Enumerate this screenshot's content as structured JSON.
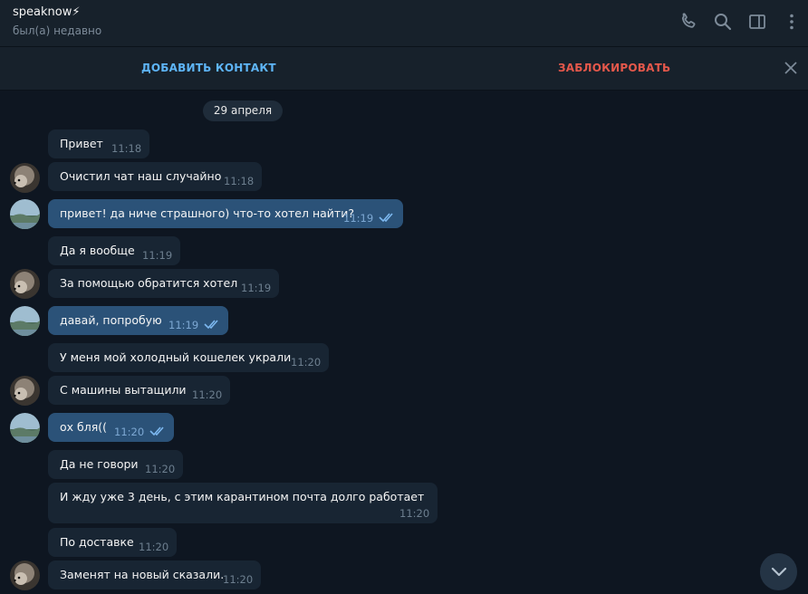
{
  "header": {
    "name": "speaknow⚡",
    "status": "был(а) недавно"
  },
  "actionbar": {
    "add_contact": "ДОБАВИТЬ КОНТАКТ",
    "block": "ЗАБЛОКИРОВАТЬ"
  },
  "date": "29 апреля",
  "colors": {
    "background": "#0e1621",
    "header": "#17212b",
    "incoming_bubble": "#182533",
    "outgoing_bubble": "#2b5278",
    "link": "#5eb5f7",
    "danger": "#e5584b"
  },
  "messages": [
    {
      "text": "Привет",
      "time": "11:18",
      "dir": "in"
    },
    {
      "text": "Очистил чат наш случайно",
      "time": "11:18",
      "dir": "in"
    },
    {
      "text": "привет! да ниче страшного) что-то хотел найти?",
      "time": "11:19",
      "dir": "out"
    },
    {
      "text": "Да я вообще",
      "time": "11:19",
      "dir": "in"
    },
    {
      "text": "За помощью обратится хотел",
      "time": "11:19",
      "dir": "in"
    },
    {
      "text": "давай, попробую",
      "time": "11:19",
      "dir": "out"
    },
    {
      "text": "У меня мой холодный кошелек украли",
      "time": "11:20",
      "dir": "in"
    },
    {
      "text": "С машины вытащили",
      "time": "11:20",
      "dir": "in"
    },
    {
      "text": "ох бля((",
      "time": "11:20",
      "dir": "out"
    },
    {
      "text": "Да не говори",
      "time": "11:20",
      "dir": "in"
    },
    {
      "text": "И жду уже 3 день, с этим карантином почта долго работает",
      "time": "11:20",
      "dir": "in"
    },
    {
      "text": "По доставке",
      "time": "11:20",
      "dir": "in"
    },
    {
      "text": "Заменят на новый сказали.",
      "time": "11:20",
      "dir": "in"
    }
  ],
  "icons": {
    "call": "phone-icon",
    "search": "search-icon",
    "sidebar": "sidebar-toggle-icon",
    "more": "more-vertical-icon",
    "close": "close-icon",
    "read": "double-check-icon",
    "scroll": "chevron-down-icon"
  }
}
